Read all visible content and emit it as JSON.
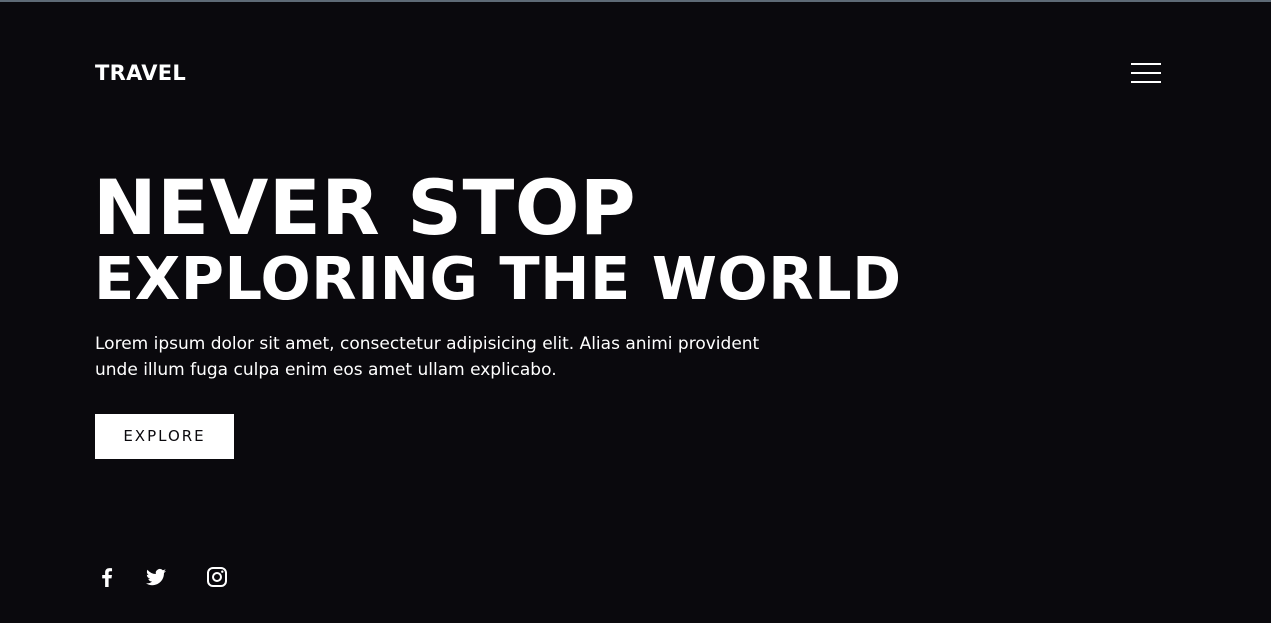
{
  "header": {
    "brand": "TRAVEL",
    "menu_icon": "hamburger-menu-icon"
  },
  "hero": {
    "headline_line1": "NEVER STOP",
    "headline_line2": "EXPLORING THE WORLD",
    "description": "Lorem ipsum dolor sit amet, consectetur adipisicing elit. Alias animi provident unde illum fuga culpa enim eos amet ullam explicabo.",
    "cta_label": "EXPLORE"
  },
  "social": {
    "icons": [
      "facebook-icon",
      "twitter-icon",
      "instagram-icon"
    ]
  },
  "colors": {
    "background": "#0a090d",
    "text": "#ffffff",
    "button_bg": "#ffffff",
    "button_text": "#0a090d",
    "top_border": "#5e6a76"
  }
}
